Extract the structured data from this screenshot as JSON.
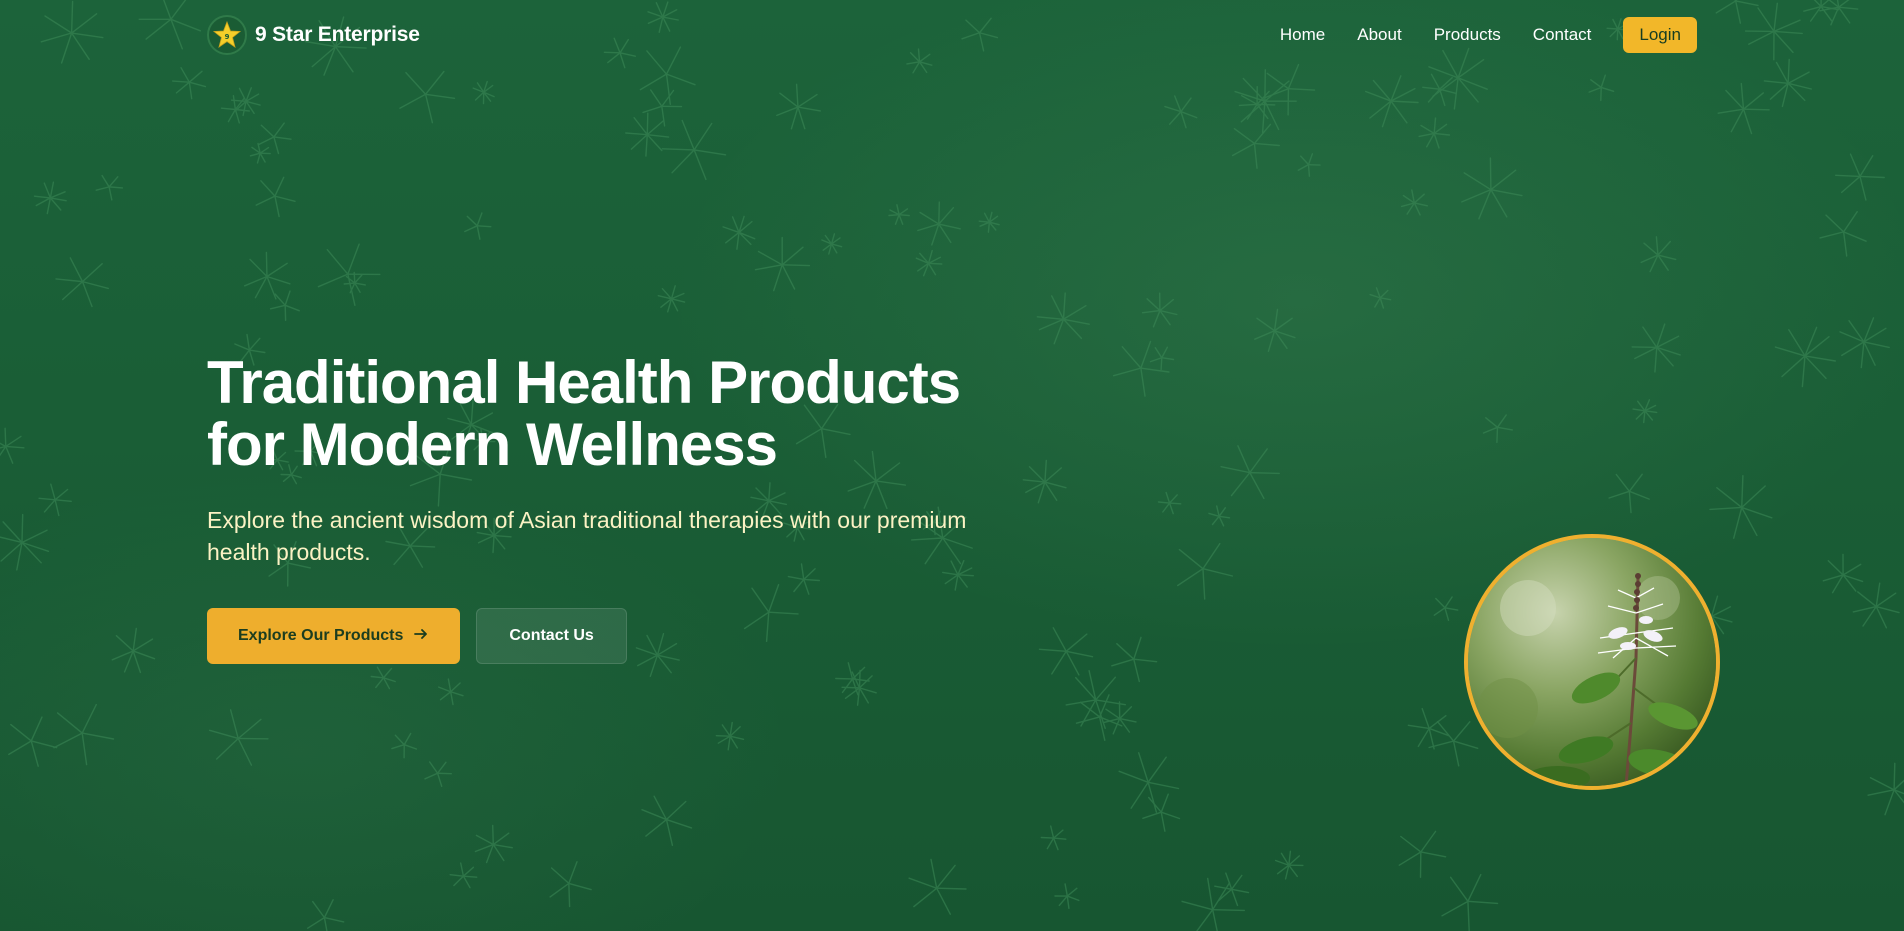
{
  "header": {
    "brand_name": "9 Star Enterprise",
    "logo_icon": "star-logo-icon",
    "nav": [
      "Home",
      "About",
      "Products",
      "Contact"
    ],
    "login_label": "Login"
  },
  "hero": {
    "headline_line1": "Traditional Health Products",
    "headline_line2": "for Modern Wellness",
    "subtext": "Explore the ancient wisdom of Asian traditional therapies with our premium health products.",
    "primary_cta": "Explore Our Products",
    "primary_cta_icon": "arrow-right-icon",
    "secondary_cta": "Contact Us"
  },
  "colors": {
    "background": "#1b5e35",
    "accent": "#eeae2d",
    "subtext": "#fbf2c4"
  }
}
